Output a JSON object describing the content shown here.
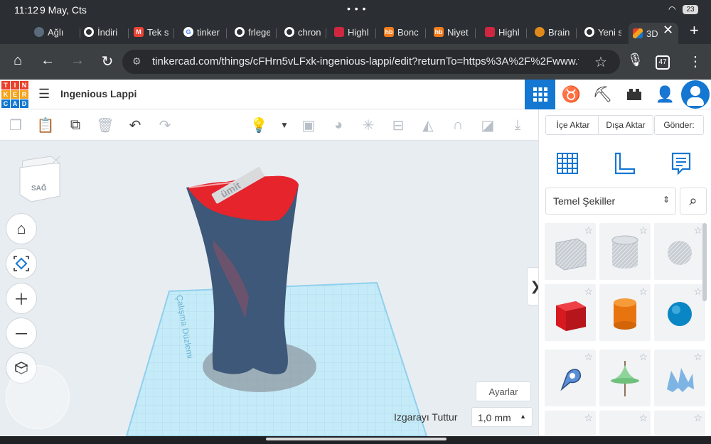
{
  "status": {
    "time": "11:12",
    "date": "9 May, Cts",
    "battery": "23"
  },
  "tabs": [
    {
      "label": "Ağlı",
      "fav_color": "#5b6b7b"
    },
    {
      "label": "İndiri",
      "fav_color": "#ffffff"
    },
    {
      "label": "Tek s",
      "fav_color": "#ea4335"
    },
    {
      "label": "tinker",
      "fav_color": "#4285f4"
    },
    {
      "label": "frlege",
      "fav_color": "#ffffff"
    },
    {
      "label": "chron",
      "fav_color": "#ffffff"
    },
    {
      "label": "Highl",
      "fav_color": "#d0263f"
    },
    {
      "label": "Bonc",
      "fav_color": "#f27a1a"
    },
    {
      "label": "Niyet",
      "fav_color": "#f27a1a"
    },
    {
      "label": "Highl",
      "fav_color": "#d0263f"
    },
    {
      "label": "Brain",
      "fav_color": "#e08a1a"
    },
    {
      "label": "Yeni s",
      "fav_color": "#ffffff"
    },
    {
      "label": "3D",
      "fav_color": "#3aa0e0"
    }
  ],
  "browser": {
    "url": "tinkercad.com/things/cFHrn5vLFxk-ingenious-lappi/edit?returnTo=https%3A%2F%2Fwww.tinke",
    "tab_count": "47"
  },
  "app": {
    "logo_letters": [
      "T",
      "I",
      "N",
      "K",
      "E",
      "R",
      "C",
      "A",
      "D"
    ],
    "logo_colors": [
      "#e8412c",
      "#e8412c",
      "#e8412c",
      "#f7a21b",
      "#f7a21b",
      "#f7a21b",
      "#1477d1",
      "#1477d1",
      "#1477d1"
    ],
    "title": "Ingenious Lappi",
    "accent": "#1477d1"
  },
  "panel": {
    "import_label": "İçe Aktar",
    "export_label": "Dışa Aktar",
    "send_label": "Gönder:",
    "shape_category": "Temel Şekiller"
  },
  "viewport": {
    "viewcube_face": "SAĞ",
    "workplane_label": "Çalışma Düzlemi",
    "settings_label": "Ayarlar",
    "snap_label": "Izgarayı Tuttur",
    "snap_value": "1,0 mm",
    "model_text": "ümit"
  }
}
